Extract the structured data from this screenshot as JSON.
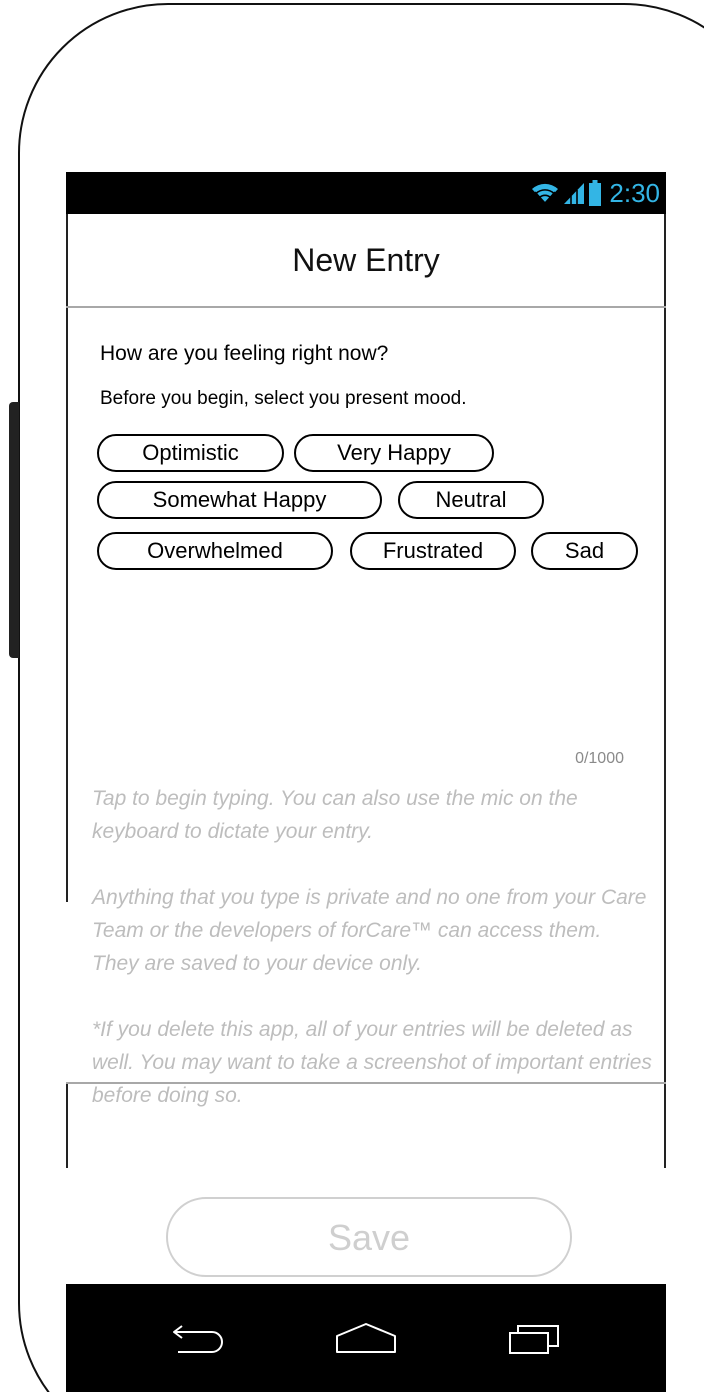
{
  "status_bar": {
    "time": "2:30",
    "icons": [
      "wifi-icon",
      "cell-signal-icon",
      "battery-icon"
    ],
    "accent_color": "#33b5e5"
  },
  "header": {
    "title": "New Entry"
  },
  "mood": {
    "question": "How are you feeling right now?",
    "instruction": "Before you begin, select you present mood.",
    "options": [
      "Optimistic",
      "Very Happy",
      "Somewhat Happy",
      "Neutral",
      "Overwhelmed",
      "Frustrated",
      "Sad"
    ]
  },
  "entry": {
    "char_count": "0/1000",
    "placeholder_1": "Tap to begin typing. You can also use the mic on the keyboard to dictate your entry.",
    "placeholder_2": "Anything that you type is private and no one from your Care Team or the developers of forCare™ can access them. They are saved to your device only.",
    "placeholder_3": "*If you delete this app, all of your entries will be deleted as well. You may want to take a screenshot of important entries before doing so."
  },
  "footer": {
    "save_label": "Save"
  },
  "nav_bar": {
    "icons": [
      "back-icon",
      "home-icon",
      "recent-apps-icon"
    ]
  }
}
